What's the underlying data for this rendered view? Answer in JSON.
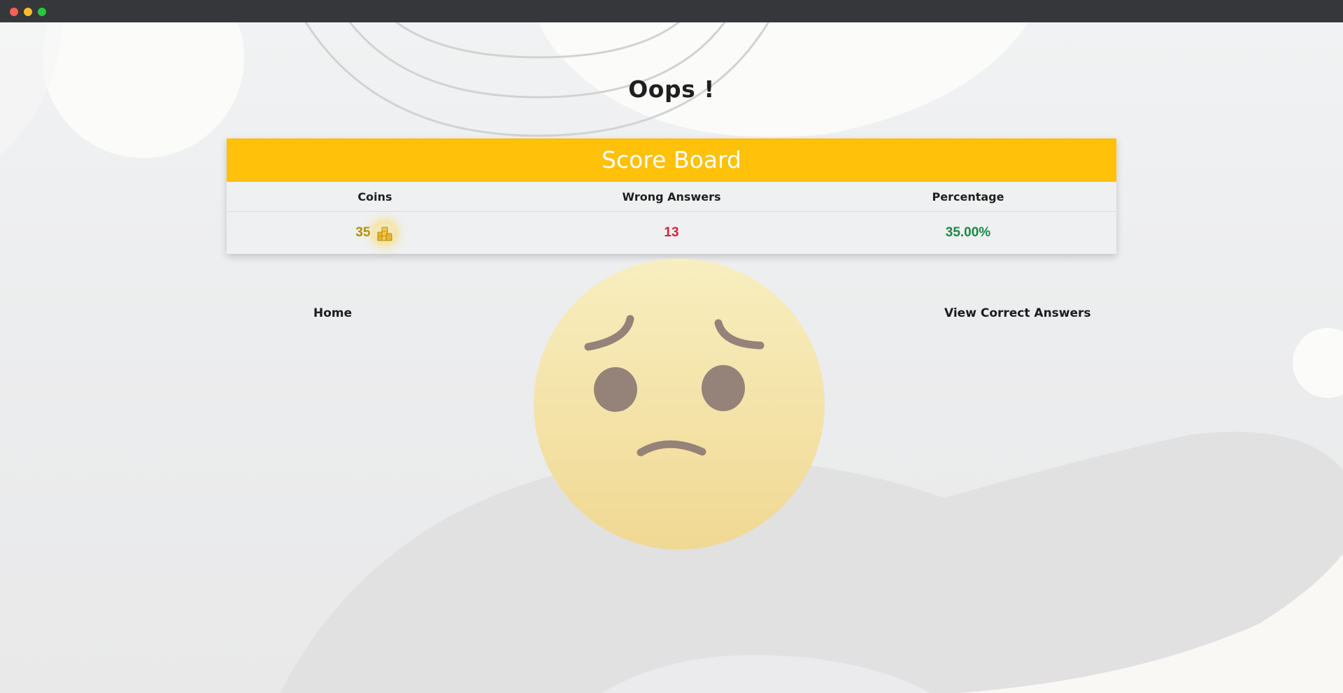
{
  "window": {
    "controls": [
      "close",
      "minimize",
      "maximize"
    ]
  },
  "page": {
    "title": "Oops !"
  },
  "scoreboard": {
    "header": "Score Board",
    "columns": [
      "Coins",
      "Wrong Answers",
      "Percentage"
    ],
    "values": {
      "coins": "35",
      "wrong_answers": "13",
      "percentage": "35.00%"
    },
    "colors": {
      "header_bg": "#ffc10a",
      "coins": "#b08d0c",
      "wrong_answers": "#d1243a",
      "percentage": "#198846"
    },
    "coin_icon": "coins-stack-icon"
  },
  "nav": {
    "home_label": "Home",
    "view_answers_label": "View Correct Answers"
  },
  "illustration": {
    "icon": "sad-face-icon"
  }
}
